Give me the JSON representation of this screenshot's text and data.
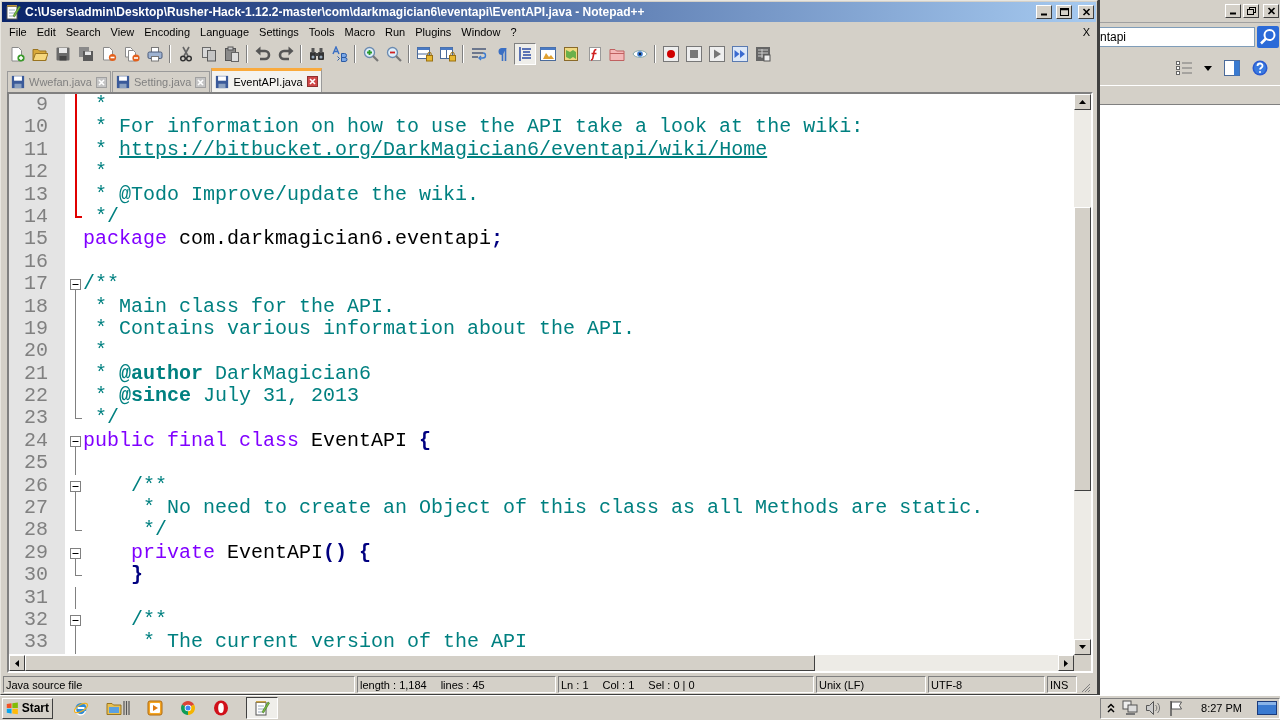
{
  "window": {
    "title": "C:\\Users\\admin\\Desktop\\Rusher-Hack-1.12.2-master\\com\\darkmagician6\\eventapi\\EventAPI.java - Notepad++"
  },
  "menu": [
    "File",
    "Edit",
    "Search",
    "View",
    "Encoding",
    "Language",
    "Settings",
    "Tools",
    "Macro",
    "Run",
    "Plugins",
    "Window",
    "?"
  ],
  "menu_close": "X",
  "toolbar_groups": [
    {
      "buttons": [
        {
          "kind": "new",
          "pressed": false
        },
        {
          "kind": "open",
          "pressed": false
        },
        {
          "kind": "save",
          "pressed": false
        },
        {
          "kind": "save-all",
          "pressed": false
        },
        {
          "kind": "close",
          "pressed": false
        },
        {
          "kind": "close-all",
          "pressed": false
        },
        {
          "kind": "print",
          "pressed": false
        }
      ]
    },
    {
      "buttons": [
        {
          "kind": "cut",
          "pressed": false
        },
        {
          "kind": "copy",
          "pressed": false
        },
        {
          "kind": "paste",
          "pressed": false
        }
      ]
    },
    {
      "buttons": [
        {
          "kind": "undo",
          "pressed": false
        },
        {
          "kind": "redo",
          "pressed": false
        }
      ]
    },
    {
      "buttons": [
        {
          "kind": "find",
          "pressed": false
        },
        {
          "kind": "replace",
          "pressed": false
        }
      ]
    },
    {
      "buttons": [
        {
          "kind": "zoom-in",
          "pressed": false
        },
        {
          "kind": "zoom-out",
          "pressed": false
        }
      ]
    },
    {
      "buttons": [
        {
          "kind": "sync-v",
          "pressed": false
        },
        {
          "kind": "sync-h",
          "pressed": false
        }
      ]
    },
    {
      "buttons": [
        {
          "kind": "wrap",
          "pressed": false
        },
        {
          "kind": "all-chars",
          "pressed": false
        },
        {
          "kind": "indent-guide",
          "pressed": true
        },
        {
          "kind": "udl",
          "pressed": false
        },
        {
          "kind": "doc-map",
          "pressed": false
        },
        {
          "kind": "function-list",
          "pressed": false
        },
        {
          "kind": "folder-workspace",
          "pressed": false
        },
        {
          "kind": "monitor",
          "pressed": false
        }
      ]
    },
    {
      "buttons": [
        {
          "kind": "record",
          "pressed": false
        },
        {
          "kind": "stop",
          "pressed": false
        },
        {
          "kind": "play",
          "pressed": false
        },
        {
          "kind": "play-multi",
          "pressed": false
        },
        {
          "kind": "save-macro",
          "pressed": false
        }
      ]
    }
  ],
  "tabs": [
    {
      "label": "Wwefan.java",
      "selected": false
    },
    {
      "label": "Setting.java",
      "selected": false
    },
    {
      "label": "EventAPI.java",
      "selected": true
    }
  ],
  "editor": {
    "lines": [
      {
        "number": "9",
        "fold": {
          "kind": "line",
          "active": true
        },
        "parts": [
          {
            "kind": "comment",
            "text": " *"
          }
        ]
      },
      {
        "number": "10",
        "fold": {
          "kind": "line",
          "active": true
        },
        "parts": [
          {
            "kind": "comment",
            "text": " * For information on how to use the API take a look at the wiki:"
          }
        ]
      },
      {
        "number": "11",
        "fold": {
          "kind": "line",
          "active": true
        },
        "parts": [
          {
            "kind": "comment",
            "text": " * "
          },
          {
            "kind": "link",
            "text": "https://bitbucket.org/DarkMagician6/eventapi/wiki/Home"
          }
        ]
      },
      {
        "number": "12",
        "fold": {
          "kind": "line",
          "active": true
        },
        "parts": [
          {
            "kind": "comment",
            "text": " *"
          }
        ]
      },
      {
        "number": "13",
        "fold": {
          "kind": "line",
          "active": true
        },
        "parts": [
          {
            "kind": "comment",
            "text": " * @Todo Improve/update the wiki."
          }
        ]
      },
      {
        "number": "14",
        "fold": {
          "kind": "end",
          "active": true
        },
        "parts": [
          {
            "kind": "comment",
            "text": " */"
          }
        ]
      },
      {
        "number": "15",
        "parts": [
          {
            "kind": "keyword",
            "text": "package"
          },
          {
            "kind": "plain",
            "text": " com.darkmagician6.eventapi"
          },
          {
            "kind": "operator",
            "text": ";"
          }
        ]
      },
      {
        "number": "16"
      },
      {
        "number": "17",
        "fold": {
          "kind": "open",
          "active": false
        },
        "parts": [
          {
            "kind": "comment",
            "text": "/**"
          }
        ]
      },
      {
        "number": "18",
        "fold": {
          "kind": "line",
          "active": false
        },
        "parts": [
          {
            "kind": "comment",
            "text": " * Main class for the API."
          }
        ]
      },
      {
        "number": "19",
        "fold": {
          "kind": "line",
          "active": false
        },
        "parts": [
          {
            "kind": "comment",
            "text": " * Contains various information about the API."
          }
        ]
      },
      {
        "number": "20",
        "fold": {
          "kind": "line",
          "active": false
        },
        "parts": [
          {
            "kind": "comment",
            "text": " *"
          }
        ]
      },
      {
        "number": "21",
        "fold": {
          "kind": "line",
          "active": false
        },
        "parts": [
          {
            "kind": "comment",
            "text": " * "
          },
          {
            "kind": "doc-tag",
            "text": "@author"
          },
          {
            "kind": "comment",
            "text": " DarkMagician6"
          }
        ]
      },
      {
        "number": "22",
        "fold": {
          "kind": "line",
          "active": false
        },
        "parts": [
          {
            "kind": "comment",
            "text": " * "
          },
          {
            "kind": "doc-tag",
            "text": "@since"
          },
          {
            "kind": "comment",
            "text": " July 31, 2013"
          }
        ]
      },
      {
        "number": "23",
        "fold": {
          "kind": "end",
          "active": false
        },
        "parts": [
          {
            "kind": "comment",
            "text": " */"
          }
        ]
      },
      {
        "number": "24",
        "fold": {
          "kind": "open",
          "active": false
        },
        "parts": [
          {
            "kind": "keyword",
            "text": "public final class"
          },
          {
            "kind": "plain",
            "text": " EventAPI "
          },
          {
            "kind": "operator",
            "text": "{"
          }
        ]
      },
      {
        "number": "25",
        "fold": {
          "kind": "line",
          "active": false
        }
      },
      {
        "number": "26",
        "fold": {
          "kind": "open",
          "active": false
        },
        "parts": [
          {
            "kind": "comment",
            "text": "    /**"
          }
        ]
      },
      {
        "number": "27",
        "fold": {
          "kind": "line",
          "active": false
        },
        "parts": [
          {
            "kind": "comment",
            "text": "     * No need to create an Object of this class as all Methods are static."
          }
        ]
      },
      {
        "number": "28",
        "fold": {
          "kind": "end",
          "active": false
        },
        "parts": [
          {
            "kind": "comment",
            "text": "     */"
          }
        ]
      },
      {
        "number": "29",
        "fold": {
          "kind": "open",
          "active": false
        },
        "parts": [
          {
            "kind": "keyword",
            "text": "    private"
          },
          {
            "kind": "plain",
            "text": " EventAPI"
          },
          {
            "kind": "operator",
            "text": "() {"
          }
        ]
      },
      {
        "number": "30",
        "fold": {
          "kind": "end",
          "active": false
        },
        "parts": [
          {
            "kind": "operator",
            "text": "    }"
          }
        ]
      },
      {
        "number": "31",
        "fold": {
          "kind": "line",
          "active": false
        }
      },
      {
        "number": "32",
        "fold": {
          "kind": "open",
          "active": false
        },
        "parts": [
          {
            "kind": "comment",
            "text": "    /**"
          }
        ]
      },
      {
        "number": "33",
        "fold": {
          "kind": "line",
          "active": false
        },
        "parts": [
          {
            "kind": "comment",
            "text": "     * The current version of the API"
          }
        ]
      }
    ]
  },
  "status_bar": {
    "sections": [
      {
        "items": [
          "Java source file"
        ]
      },
      {
        "items": [
          "length : 1,184",
          "lines : 45"
        ]
      },
      {
        "items": [
          "Ln : 1",
          "Col : 1",
          "Sel : 0 | 0"
        ]
      },
      {
        "items": [
          "Unix (LF)"
        ]
      },
      {
        "items": [
          "UTF-8"
        ]
      },
      {
        "items": [
          "INS"
        ]
      }
    ]
  },
  "side_window": {
    "search": {
      "value": "ntapi"
    }
  },
  "taskbar": {
    "start": "Start",
    "apps": [
      {
        "kind": "browser",
        "selected": false
      },
      {
        "kind": "files",
        "selected": false
      },
      {
        "kind": "media",
        "selected": false
      },
      {
        "kind": "web",
        "selected": false
      },
      {
        "kind": "o-ring",
        "selected": false
      },
      {
        "kind": "notepad",
        "selected": true
      }
    ],
    "clock": "8:27 PM"
  }
}
